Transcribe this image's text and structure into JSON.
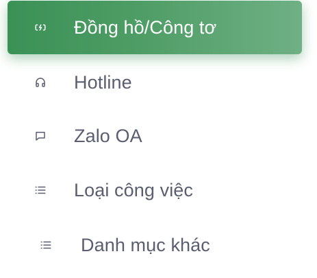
{
  "menu": {
    "items": [
      {
        "label": "Đồng hồ/Công tơ",
        "icon": "meter-icon",
        "active": true
      },
      {
        "label": "Hotline",
        "icon": "headphones-icon",
        "active": false
      },
      {
        "label": "Zalo OA",
        "icon": "chat-icon",
        "active": false
      },
      {
        "label": "Loại công việc",
        "icon": "list-icon",
        "active": false
      },
      {
        "label": "Danh mục khác",
        "icon": "list-icon",
        "active": false
      }
    ]
  },
  "colors": {
    "active_bg_start": "#3a9156",
    "active_bg_end": "#6fb084",
    "active_text": "#ffffff",
    "text": "#5b5e70"
  }
}
